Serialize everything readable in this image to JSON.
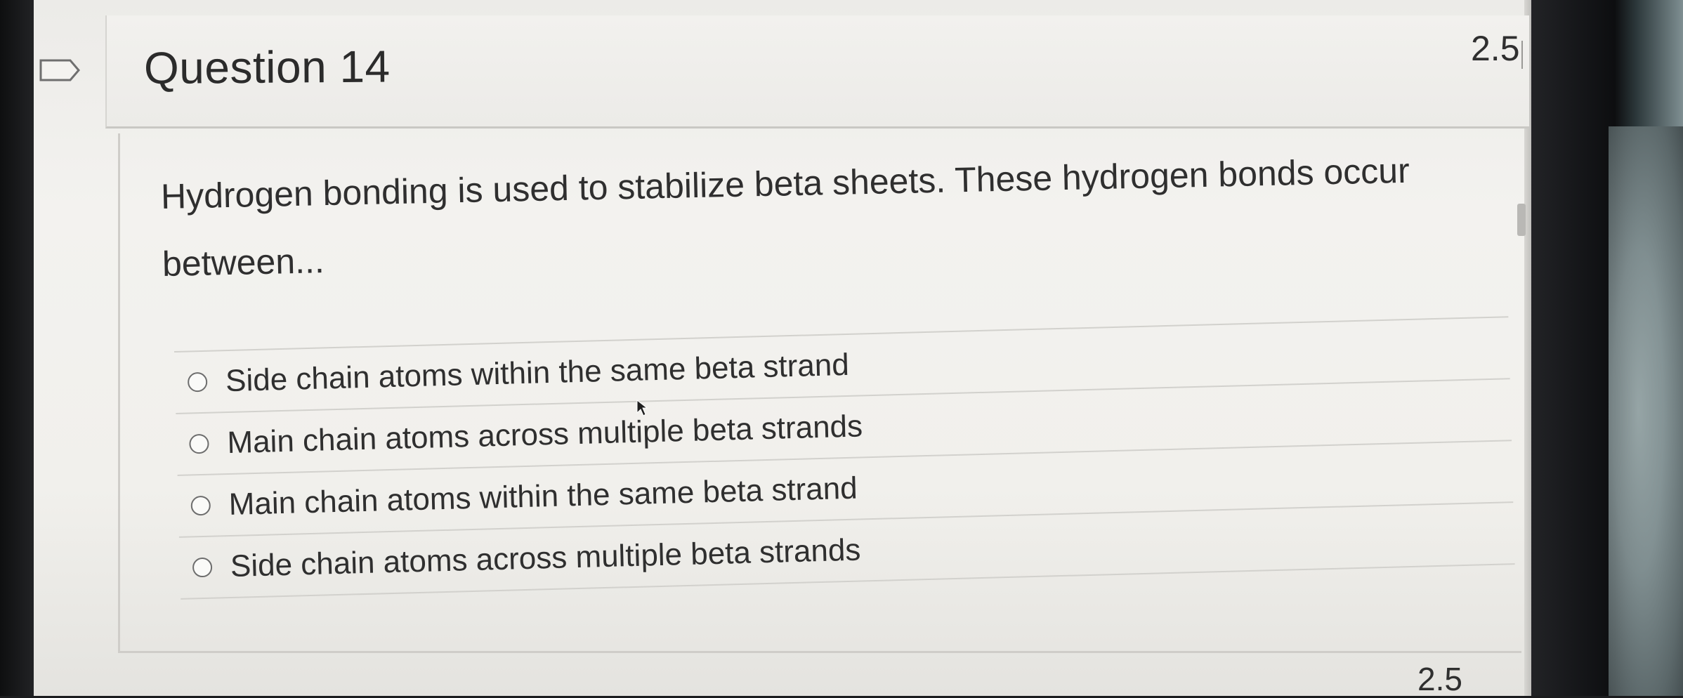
{
  "question": {
    "title": "Question 14",
    "points": "2.5",
    "prompt_line1": "Hydrogen bonding is used to stabilize beta sheets. These hydrogen bonds occur",
    "prompt_line2": "between...",
    "answers": [
      {
        "label": "Side chain atoms within the same beta strand",
        "selected": false
      },
      {
        "label": "Main chain atoms across multiple beta strands",
        "selected": false
      },
      {
        "label": "Main chain atoms within the same beta strand",
        "selected": false
      },
      {
        "label": "Side chain atoms across multiple beta strands",
        "selected": false
      }
    ]
  },
  "next_question": {
    "points": "2.5"
  },
  "icons": {
    "flag": "flag-icon",
    "cursor": "mouse-pointer-icon",
    "radio": "radio-button-icon"
  }
}
